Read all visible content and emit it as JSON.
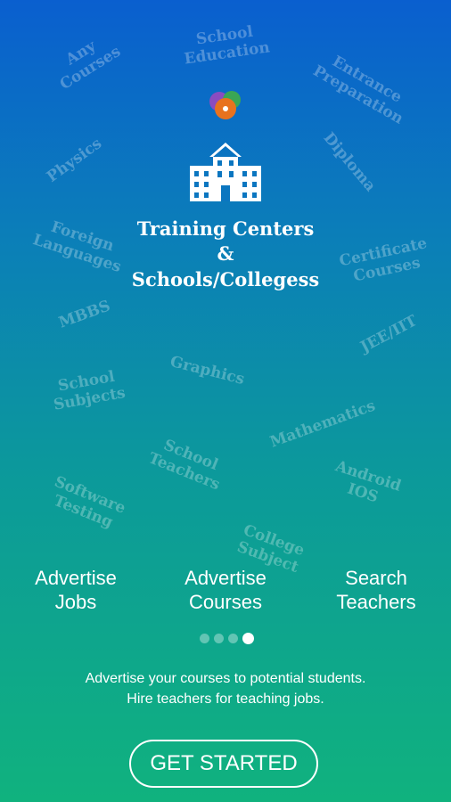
{
  "background_words": [
    "Any\nCourses",
    "School\nEducation",
    "Entrance\nPreparation",
    "Physics",
    "Diploma",
    "Foreign\nLanguages",
    "Certificate\nCourses",
    "MBBS",
    "JEE/IIT",
    "School\nSubjects",
    "Graphics",
    "Mathematics",
    "School\nTeachers",
    "Android\nIOS",
    "Software\nTesting",
    "College\nSubject"
  ],
  "hero": {
    "logo_icon": "app-logo-icon",
    "building_icon": "school-building-icon",
    "line1": "Training Centers",
    "line2": "&",
    "line3": "Schools/Collegess"
  },
  "features": [
    {
      "line1": "Advertise",
      "line2": "Jobs"
    },
    {
      "line1": "Advertise",
      "line2": "Courses"
    },
    {
      "line1": "Search",
      "line2": "Teachers"
    }
  ],
  "pager": {
    "total": 4,
    "active_index": 3
  },
  "description": {
    "line1": "Advertise your courses to potential students.",
    "line2": "Hire teachers for teaching jobs."
  },
  "cta": {
    "label": "GET STARTED"
  },
  "colors": {
    "gradient_top": "#0a5fcf",
    "gradient_bottom": "#10b27e",
    "logo_orange": "#e8721e",
    "logo_green": "#3aa655",
    "logo_purple": "#8a4cc0"
  }
}
